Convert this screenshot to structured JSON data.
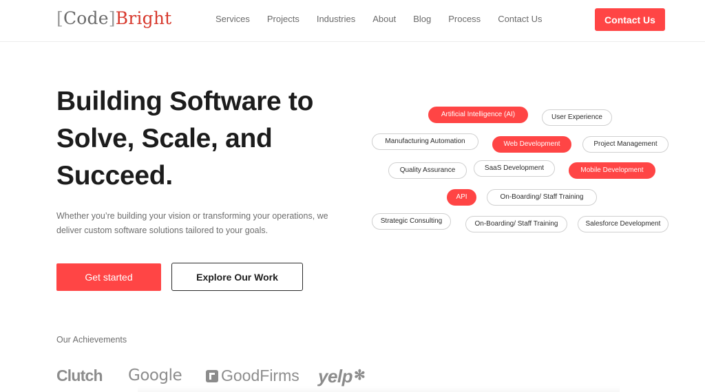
{
  "brand": {
    "bracket_open": "[",
    "code": "Code",
    "bracket_close": "]",
    "bright": "Bright"
  },
  "nav": {
    "services": "Services",
    "projects": "Projects",
    "industries": "Industries",
    "about": "About",
    "blog": "Blog",
    "process": "Process",
    "contact": "Contact Us"
  },
  "header_cta": "Contact Us",
  "hero": {
    "title_line1": "Building Software to",
    "title_line2": "Solve, Scale, and",
    "title_line3": "Succeed.",
    "subtitle": "Whether you’re building your vision or transforming your operations, we deliver custom software solutions tailored to your goals.",
    "primary_button": "Get started",
    "secondary_button": "Explore Our Work"
  },
  "tags": {
    "ai": "Artificial Intelligence (AI)",
    "ux": "User Experience",
    "manufacturing": "Manufacturing Automation",
    "web": "Web Development",
    "project_mgmt": "Project Management",
    "qa": "Quality Assurance",
    "saas": "SaaS Development",
    "mobile": "Mobile Development",
    "api": "API",
    "onboarding_1": "On-Boarding/ Staff Training",
    "strategic": "Strategic Consulting",
    "onboarding_2": "On-Boarding/ Staff Training",
    "salesforce": "Salesforce Development"
  },
  "achievements": {
    "title": "Our Achievements",
    "clutch": "Clutch",
    "google": "Google",
    "goodfirms": "GoodFirms",
    "yelp": "yelp",
    "yelp_burst": "✻"
  },
  "colors": {
    "accent": "#ff4545",
    "logo_red": "#d7382c",
    "text_dark": "#1c1c1c",
    "text_muted": "#6d6d6d"
  }
}
